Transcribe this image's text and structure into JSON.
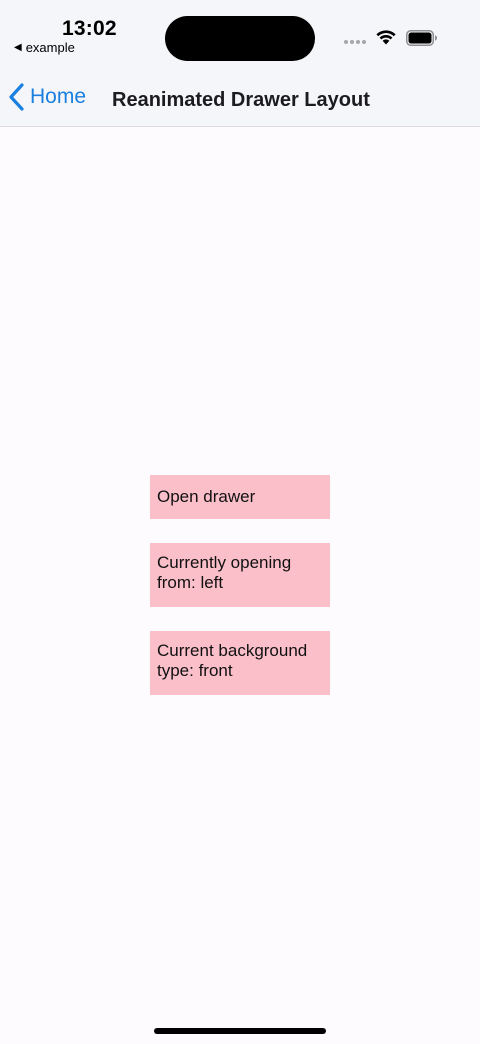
{
  "status_bar": {
    "time": "13:02",
    "back_app_label": "example",
    "icons": [
      "cellular-icon",
      "wifi-icon",
      "battery-icon"
    ]
  },
  "nav": {
    "back_label": "Home",
    "title": "Reanimated Drawer Layout",
    "accent_color": "#1a7fe0"
  },
  "buttons": {
    "open_drawer": "Open drawer",
    "opening_from": "Currently opening from: left",
    "background_type": "Current background type: front",
    "color": "#fbbfca"
  }
}
